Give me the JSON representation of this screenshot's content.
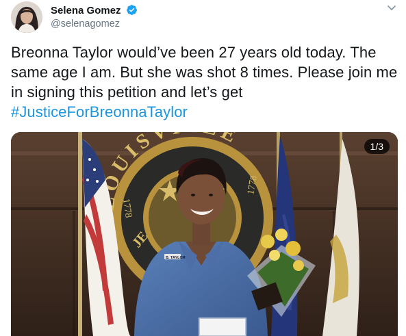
{
  "tweet": {
    "author": {
      "display_name": "Selena Gomez",
      "handle": "@selenagomez",
      "verified": true,
      "avatar_icon": "avatar-photo"
    },
    "menu_icon": "chevron-down-icon",
    "text_lines": [
      "Breonna Taylor would’ve been 27 years old today. The",
      "same age I am. But she was shot 8 times. Please join me",
      "in signing this petition and let’s get"
    ],
    "hashtag": "#JusticeForBreonnaTaylor",
    "media": {
      "counter": "1/3",
      "seal_text_top": "LOUISVILLE",
      "seal_year_left": "1778",
      "seal_year_right": "1778",
      "seal_text_bottom": "JE",
      "shirt_label": "B. TAYLOR"
    }
  },
  "colors": {
    "link": "#1b95e0",
    "verified": "#1da1f2",
    "handle": "#657786",
    "text": "#14171a"
  }
}
